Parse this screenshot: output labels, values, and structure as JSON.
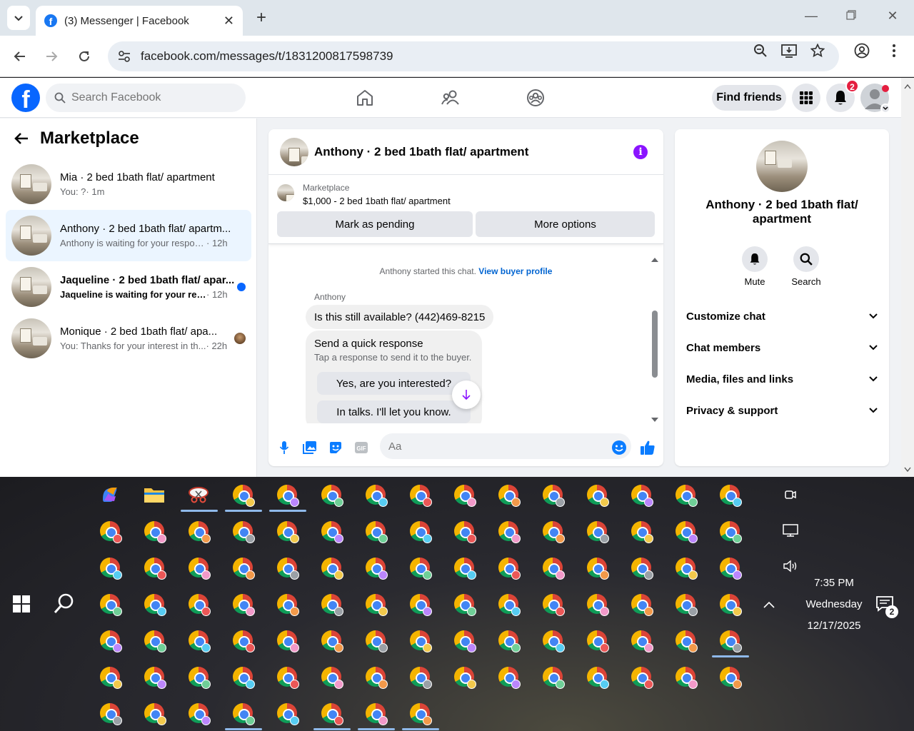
{
  "browser": {
    "tab_title": "(3) Messenger | Facebook",
    "favicon_letter": "f",
    "url": "facebook.com/messages/t/1831200817598739"
  },
  "fb_header": {
    "search_placeholder": "Search Facebook",
    "logo_letter": "f",
    "find_friends": "Find friends",
    "notifications_count": "2"
  },
  "chat_list": {
    "title": "Marketplace",
    "items": [
      {
        "name": "Mia · 2 bed 1bath flat/ apartment",
        "message": "You: ?",
        "time": "· 1m",
        "bold": false
      },
      {
        "name": "Anthony · 2 bed 1bath flat/ apartm...",
        "message": "Anthony is waiting for your response.",
        "time": "· 12h",
        "bold": false
      },
      {
        "name": "Jaqueline · 2 bed 1bath flat/ apar...",
        "message": "Jaqueline is waiting for your resp...",
        "time": "· 12h",
        "bold": true
      },
      {
        "name": "Monique · 2 bed 1bath flat/ apa...",
        "message": "You: Thanks for your interest in th...",
        "time": "· 22h",
        "bold": false
      }
    ]
  },
  "conversation": {
    "title": "Anthony · 2 bed 1bath flat/ apartment",
    "info_glyph": "i",
    "listing_source": "Marketplace",
    "listing_title": "$1,000 - 2 bed 1bath flat/ apartment",
    "mark_pending": "Mark as pending",
    "more_options": "More options",
    "system_message": "Anthony started this chat.",
    "view_buyer_profile": "View buyer profile",
    "sender": "Anthony",
    "incoming_message": "Is this still available? (442)469-8215",
    "quick_response_title": "Send a quick response",
    "quick_response_sub": "Tap a response to send it to the buyer.",
    "quick_replies": [
      "Yes, are you interested?",
      "In talks. I'll let you know."
    ],
    "composer_placeholder": "Aa"
  },
  "right_panel": {
    "name": "Anthony · 2 bed 1bath flat/ apartment",
    "actions": [
      {
        "label": "Mute",
        "icon": "bell-icon"
      },
      {
        "label": "Search",
        "icon": "search-icon"
      }
    ],
    "sections": [
      "Customize chat",
      "Chat members",
      "Media, files and links",
      "Privacy & support"
    ]
  },
  "taskbar": {
    "time": "7:35 PM",
    "day": "Wednesday",
    "date": "12/17/2025",
    "notification_count": "2"
  },
  "colors": {
    "fb_blue": "#0866ff",
    "messenger_purple": "#8a14ff",
    "notification_red": "#e41e3f"
  }
}
